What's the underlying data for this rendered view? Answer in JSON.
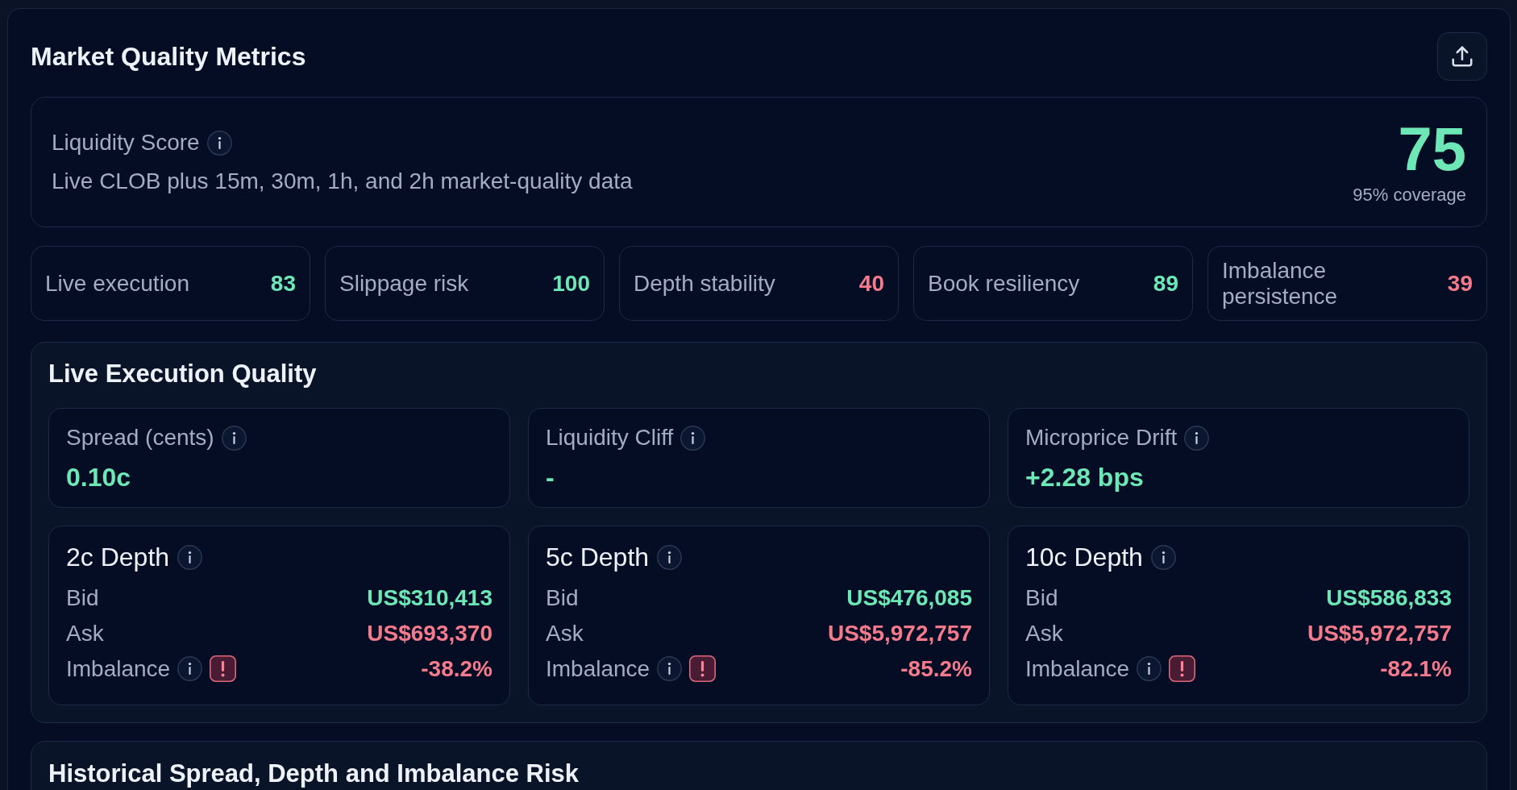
{
  "header": {
    "title": "Market Quality Metrics"
  },
  "liquidity_score": {
    "label": "Liquidity Score",
    "description": "Live CLOB plus 15m, 30m, 1h, and 2h market-quality data",
    "score": "75",
    "coverage": "95% coverage"
  },
  "components": [
    {
      "label": "Live execution",
      "value": "83",
      "color": "#6ee7b7"
    },
    {
      "label": "Slippage risk",
      "value": "100",
      "color": "#6ee7b7"
    },
    {
      "label": "Depth stability",
      "value": "40",
      "color": "#f47a8c"
    },
    {
      "label": "Book resiliency",
      "value": "89",
      "color": "#6ee7b7"
    },
    {
      "label": "Imbalance persistence",
      "value": "39",
      "color": "#f47a8c"
    }
  ],
  "live_execution": {
    "title": "Live Execution Quality",
    "metrics": [
      {
        "label": "Spread (cents)",
        "value": "0.10c",
        "color": "#6ee7b7"
      },
      {
        "label": "Liquidity Cliff",
        "value": "-",
        "color": "#6ee7b7"
      },
      {
        "label": "Microprice Drift",
        "value": "+2.28 bps",
        "color": "#6ee7b7"
      }
    ],
    "depths": [
      {
        "title": "2c Depth",
        "rows": [
          {
            "kind": "bid",
            "label": "Bid",
            "value": "US$310,413",
            "color": "#6ee7b7"
          },
          {
            "kind": "ask",
            "label": "Ask",
            "value": "US$693,370",
            "color": "#f47a8c"
          },
          {
            "kind": "imbalance",
            "label": "Imbalance",
            "value": "-38.2%",
            "color": "#f47a8c",
            "warning": true
          }
        ]
      },
      {
        "title": "5c Depth",
        "rows": [
          {
            "kind": "bid",
            "label": "Bid",
            "value": "US$476,085",
            "color": "#6ee7b7"
          },
          {
            "kind": "ask",
            "label": "Ask",
            "value": "US$5,972,757",
            "color": "#f47a8c"
          },
          {
            "kind": "imbalance",
            "label": "Imbalance",
            "value": "-85.2%",
            "color": "#f47a8c",
            "warning": true
          }
        ]
      },
      {
        "title": "10c Depth",
        "rows": [
          {
            "kind": "bid",
            "label": "Bid",
            "value": "US$586,833",
            "color": "#6ee7b7"
          },
          {
            "kind": "ask",
            "label": "Ask",
            "value": "US$5,972,757",
            "color": "#f47a8c"
          },
          {
            "kind": "imbalance",
            "label": "Imbalance",
            "value": "-82.1%",
            "color": "#f47a8c",
            "warning": true
          }
        ]
      }
    ]
  },
  "historical": {
    "title": "Historical Spread, Depth and Imbalance Risk"
  }
}
